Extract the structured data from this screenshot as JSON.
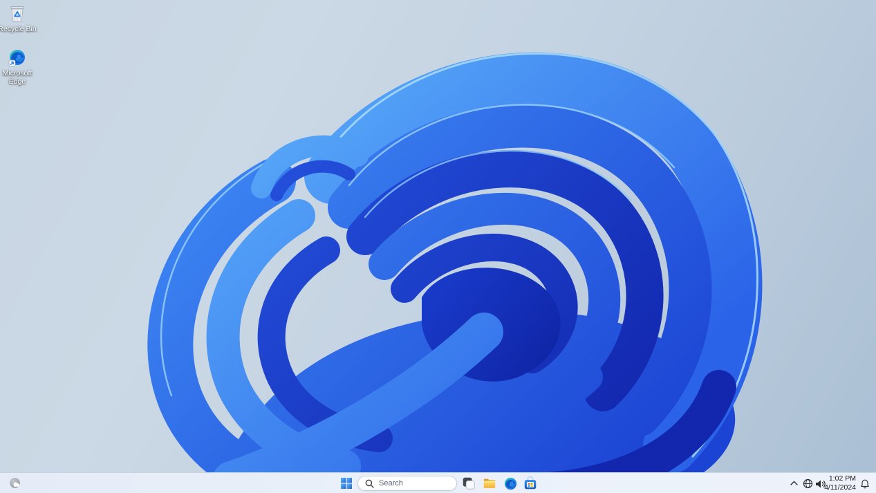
{
  "desktop": {
    "icons": [
      {
        "name": "recycle-bin",
        "label": "Recycle Bin"
      },
      {
        "name": "microsoft-edge-shortcut",
        "label": "Microsoft Edge"
      }
    ]
  },
  "taskbar": {
    "widgets_icon": "widgets-weather-icon",
    "start_icon": "windows-start-icon",
    "search": {
      "icon": "search-icon",
      "placeholder": "Search"
    },
    "app_icons": [
      "task-view-icon",
      "file-explorer-icon",
      "microsoft-edge-icon",
      "microsoft-store-icon"
    ],
    "tray": {
      "hidden_icons_icon": "chevron-up-icon",
      "network_icon": "globe-network-icon",
      "volume_icon": "speaker-volume-icon",
      "time": "1:02 PM",
      "date": "4/11/2024",
      "notification_icon": "notification-bell-icon"
    }
  },
  "colors": {
    "taskbar_bg": "#eaf0f9",
    "wallpaper_bg_top": "#cbd8e5",
    "wallpaper_bg_bottom": "#aabfd4",
    "bloom_bright": "#4f9ff8",
    "bloom_mid": "#2c6fee",
    "bloom_deep": "#1733c6",
    "search_text": "#5a6472",
    "clock_text": "#1a1a1a",
    "start_logo": "#3f8cf3"
  }
}
